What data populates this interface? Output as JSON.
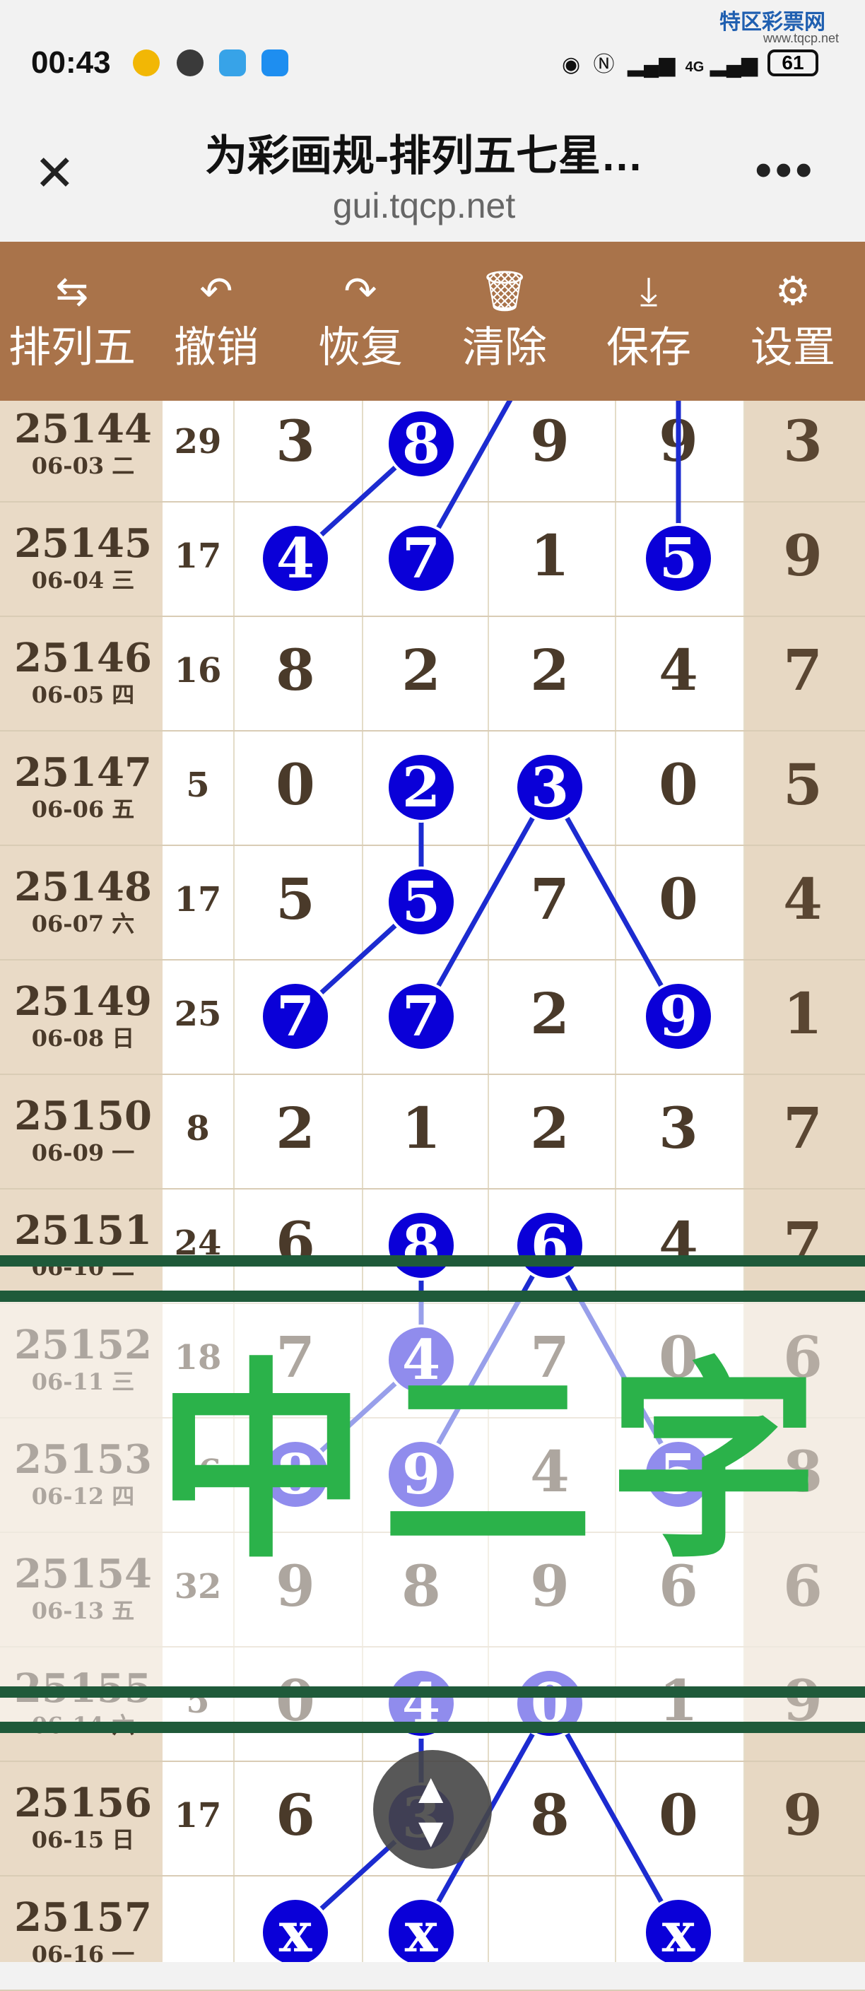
{
  "status_bar": {
    "time": "00:43",
    "network": "4G",
    "battery": "61",
    "watermark_name": "特区彩票网",
    "watermark_url": "www.tqcp.net"
  },
  "browser": {
    "title": "为彩画规-排列五七星…",
    "url": "gui.tqcp.net",
    "close_icon": "✕",
    "more_icon": "•••"
  },
  "toolbar": {
    "items": [
      {
        "label": "排列五",
        "icon": "switch-arrows-icon",
        "glyph": "⇆"
      },
      {
        "label": "撤销",
        "icon": "undo-icon",
        "glyph": "↶"
      },
      {
        "label": "恢复",
        "icon": "redo-icon",
        "glyph": "↷"
      },
      {
        "label": "清除",
        "icon": "trash-icon",
        "glyph": "🗑"
      },
      {
        "label": "保存",
        "icon": "download-icon",
        "glyph": "⤓"
      },
      {
        "label": "设置",
        "icon": "gear-icon",
        "glyph": "⚙"
      }
    ]
  },
  "rows": [
    {
      "issue": "25144",
      "date": "06-03 二",
      "sum": "29",
      "digits": [
        "3",
        "8",
        "9",
        "9",
        "3"
      ]
    },
    {
      "issue": "25145",
      "date": "06-04 三",
      "sum": "17",
      "digits": [
        "4",
        "7",
        "1",
        "5",
        "9"
      ]
    },
    {
      "issue": "25146",
      "date": "06-05 四",
      "sum": "16",
      "digits": [
        "8",
        "2",
        "2",
        "4",
        "7"
      ]
    },
    {
      "issue": "25147",
      "date": "06-06 五",
      "sum": "5",
      "digits": [
        "0",
        "2",
        "3",
        "0",
        "5"
      ]
    },
    {
      "issue": "25148",
      "date": "06-07 六",
      "sum": "17",
      "digits": [
        "5",
        "5",
        "7",
        "0",
        "4"
      ]
    },
    {
      "issue": "25149",
      "date": "06-08 日",
      "sum": "25",
      "digits": [
        "7",
        "7",
        "2",
        "9",
        "1"
      ]
    },
    {
      "issue": "25150",
      "date": "06-09 一",
      "sum": "8",
      "digits": [
        "2",
        "1",
        "2",
        "3",
        "7"
      ]
    },
    {
      "issue": "25151",
      "date": "06-10 二",
      "sum": "24",
      "digits": [
        "6",
        "8",
        "6",
        "4",
        "7"
      ]
    },
    {
      "issue": "25152",
      "date": "06-11 三",
      "sum": "18",
      "digits": [
        "7",
        "4",
        "7",
        "0",
        "6"
      ]
    },
    {
      "issue": "25153",
      "date": "06-12 四",
      "sum": "26",
      "digits": [
        "8",
        "9",
        "4",
        "5",
        "8"
      ]
    },
    {
      "issue": "25154",
      "date": "06-13 五",
      "sum": "32",
      "digits": [
        "9",
        "8",
        "9",
        "6",
        "6"
      ]
    },
    {
      "issue": "25155",
      "date": "06-14 六",
      "sum": "5",
      "digits": [
        "0",
        "4",
        "0",
        "1",
        "9"
      ]
    },
    {
      "issue": "25156",
      "date": "06-15 日",
      "sum": "17",
      "digits": [
        "6",
        "3",
        "8",
        "0",
        "9"
      ]
    },
    {
      "issue": "25157",
      "date": "06-16 一",
      "sum": "",
      "digits": [
        "x",
        "x",
        "",
        "x",
        ""
      ]
    }
  ],
  "balls": [
    {
      "row": 0,
      "col": 1,
      "text": "8"
    },
    {
      "row": 1,
      "col": 0,
      "text": "4"
    },
    {
      "row": 1,
      "col": 1,
      "text": "7"
    },
    {
      "row": 1,
      "col": 3,
      "text": "5"
    },
    {
      "row": 3,
      "col": 1,
      "text": "2"
    },
    {
      "row": 3,
      "col": 2,
      "text": "3"
    },
    {
      "row": 4,
      "col": 1,
      "text": "5"
    },
    {
      "row": 5,
      "col": 0,
      "text": "7"
    },
    {
      "row": 5,
      "col": 1,
      "text": "7"
    },
    {
      "row": 5,
      "col": 3,
      "text": "9"
    },
    {
      "row": 7,
      "col": 1,
      "text": "8"
    },
    {
      "row": 7,
      "col": 2,
      "text": "6"
    },
    {
      "row": 8,
      "col": 1,
      "text": "4"
    },
    {
      "row": 9,
      "col": 0,
      "text": "8"
    },
    {
      "row": 9,
      "col": 1,
      "text": "9"
    },
    {
      "row": 9,
      "col": 3,
      "text": "5"
    },
    {
      "row": 11,
      "col": 1,
      "text": "4"
    },
    {
      "row": 11,
      "col": 2,
      "text": "0"
    },
    {
      "row": 12,
      "col": 1,
      "text": "3"
    },
    {
      "row": 13,
      "col": 0,
      "text": "x"
    },
    {
      "row": 13,
      "col": 1,
      "text": "x"
    },
    {
      "row": 13,
      "col": 3,
      "text": "x"
    }
  ],
  "links": [
    [
      [
        1,
        0
      ],
      [
        0,
        1
      ]
    ],
    [
      [
        1,
        1
      ],
      [
        -1,
        2
      ]
    ],
    [
      [
        -1,
        3
      ],
      [
        1,
        3
      ]
    ],
    [
      [
        3,
        1
      ],
      [
        4,
        1
      ]
    ],
    [
      [
        4,
        1
      ],
      [
        5,
        0
      ]
    ],
    [
      [
        3,
        2
      ],
      [
        5,
        1
      ]
    ],
    [
      [
        3,
        2
      ],
      [
        5,
        3
      ]
    ],
    [
      [
        7,
        1
      ],
      [
        8,
        1
      ]
    ],
    [
      [
        8,
        1
      ],
      [
        9,
        0
      ]
    ],
    [
      [
        7,
        2
      ],
      [
        9,
        1
      ]
    ],
    [
      [
        7,
        2
      ],
      [
        9,
        3
      ]
    ],
    [
      [
        11,
        1
      ],
      [
        12,
        1
      ]
    ],
    [
      [
        12,
        1
      ],
      [
        13,
        0
      ]
    ],
    [
      [
        11,
        2
      ],
      [
        13,
        1
      ]
    ],
    [
      [
        11,
        2
      ],
      [
        13,
        3
      ]
    ]
  ],
  "overlay": {
    "banner": "中二字"
  },
  "colors": {
    "toolbar": "#a9734a",
    "ball": "#0a00d8",
    "link": "#1c2bd0",
    "banner": "#2bb24a",
    "band": "#1f5a3a"
  }
}
